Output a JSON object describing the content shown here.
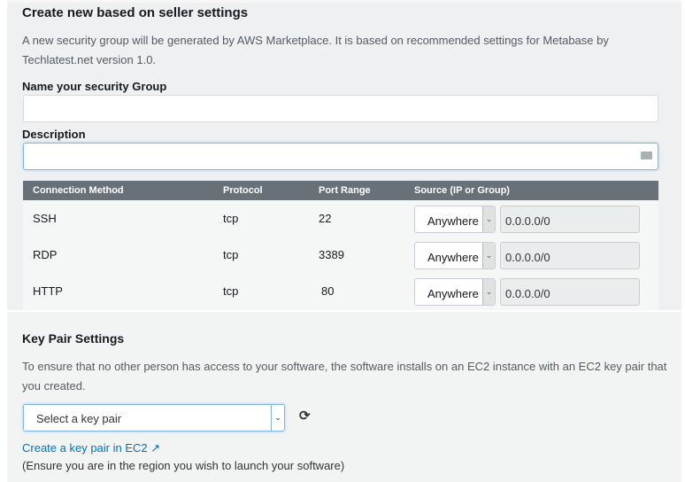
{
  "security": {
    "title": "Create new based on seller settings",
    "description": "A new security group will be generated by AWS Marketplace. It is based on recommended settings for Metabase by Techlatest.net version 1.0.",
    "name_label": "Name your security Group",
    "name_value": "",
    "description_label": "Description",
    "description_value": ""
  },
  "table": {
    "headers": [
      "Connection Method",
      "Protocol",
      "Port Range",
      "Source (IP or Group)"
    ],
    "rows": [
      {
        "method": "SSH",
        "protocol": "tcp",
        "port": "22",
        "source": "Anywhere",
        "ip": "0.0.0.0/0"
      },
      {
        "method": "RDP",
        "protocol": "tcp",
        "port": "3389",
        "source": "Anywhere",
        "ip": "0.0.0.0/0"
      },
      {
        "method": "HTTP",
        "protocol": "tcp",
        "port": "80",
        "source": "Anywhere",
        "ip": "0.0.0.0/0"
      }
    ]
  },
  "keypair": {
    "title": "Key Pair Settings",
    "description": "To ensure that no other person has access to your software, the software installs on an EC2 instance with an EC2 key pair that you created.",
    "select_placeholder": "Select a key pair",
    "create_link": "Create a key pair in EC2",
    "note": "(Ensure you are in the region you wish to launch your software)"
  },
  "colors": {
    "header_bg": "#687078",
    "link": "#0073bb",
    "focus": "#7fb5e6"
  }
}
